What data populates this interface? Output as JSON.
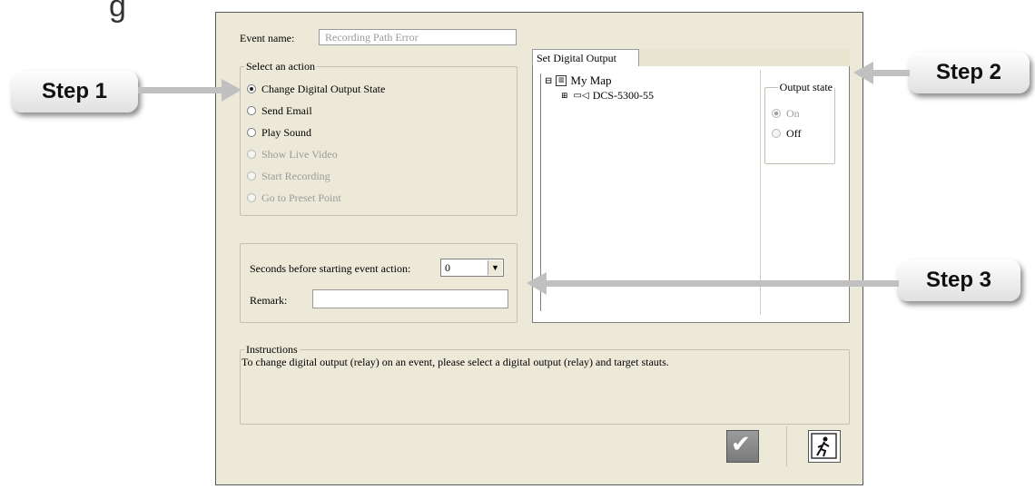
{
  "page_heading_fragment": "g",
  "dialog": {
    "event_name_label": "Event name:",
    "event_name_value": "Recording Path Error",
    "select_action_legend": "Select an action",
    "actions": [
      {
        "label": "Change Digital Output State",
        "checked": true,
        "enabled": true
      },
      {
        "label": "Send Email",
        "checked": false,
        "enabled": true
      },
      {
        "label": "Play Sound",
        "checked": false,
        "enabled": true
      },
      {
        "label": "Show Live Video",
        "checked": false,
        "enabled": false
      },
      {
        "label": "Start Recording",
        "checked": false,
        "enabled": false
      },
      {
        "label": "Go to Preset Point",
        "checked": false,
        "enabled": false
      }
    ],
    "seconds_label": "Seconds before starting event action:",
    "seconds_value": "0",
    "remark_label": "Remark:",
    "remark_value": "",
    "tab_label": "Set Digital Output",
    "tree": {
      "root_label": "My Map",
      "child_label": "DCS-5300-55"
    },
    "output_state": {
      "legend": "Output state",
      "options": [
        {
          "label": "On",
          "checked": true
        },
        {
          "label": "Off",
          "checked": false
        }
      ]
    },
    "instructions_legend": "Instructions",
    "instructions_text": "To change digital output (relay) on an event, please select a digital output (relay) and target stauts.",
    "ok_icon": "checkmark-icon",
    "exit_icon": "exit-icon"
  },
  "callouts": {
    "step1": "Step 1",
    "step2": "Step 2",
    "step3": "Step 3"
  },
  "colors": {
    "dialog_bg": "#ece9d8",
    "ok_button_bg": "#8a8a8a",
    "arrow_color": "#c0c0c0"
  }
}
